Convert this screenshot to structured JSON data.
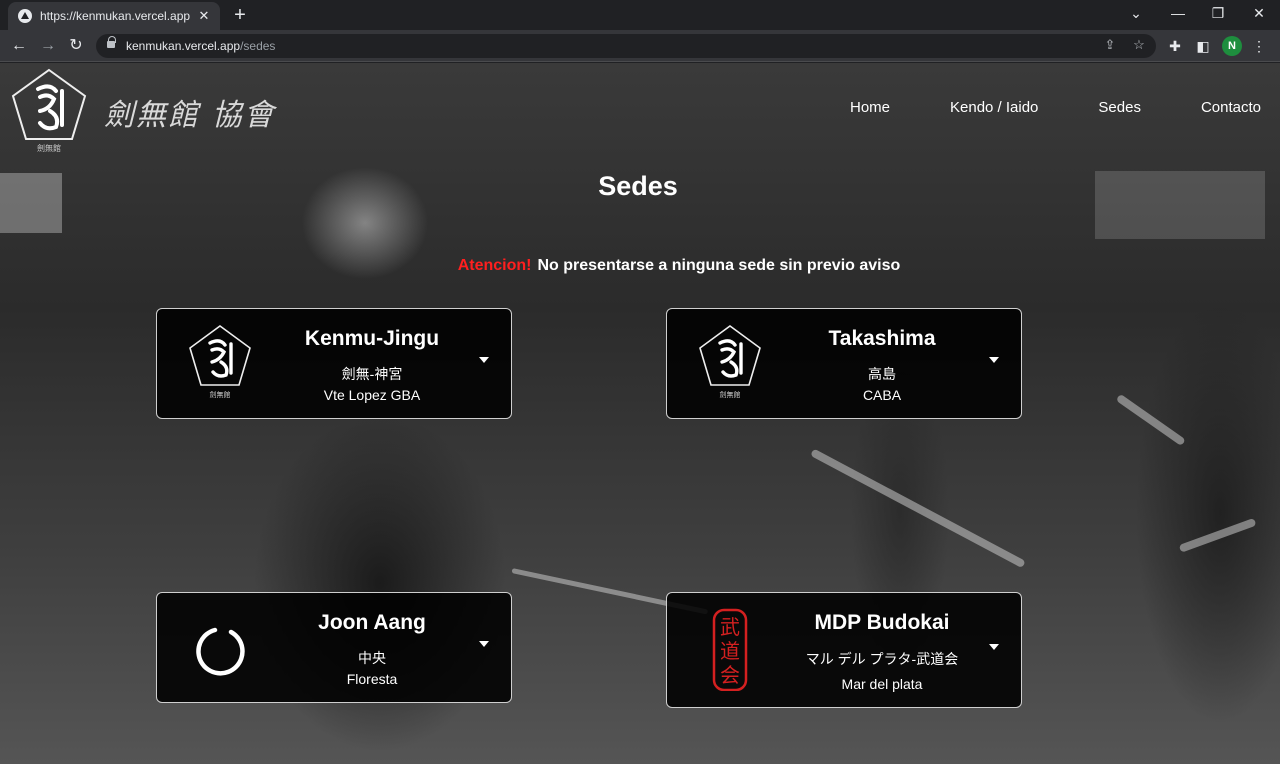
{
  "browser": {
    "tab_title": "https://kenmukan.vercel.app/sedes",
    "url_domain": "kenmukan.vercel.app",
    "url_path": "/sedes",
    "profile_initial": "N"
  },
  "site": {
    "brand_text": "劍無館 協會",
    "logo_caption": "劍無館",
    "nav": [
      "Home",
      "Kendo / Iaido",
      "Sedes",
      "Contacto"
    ]
  },
  "page": {
    "title": "Sedes",
    "notice_alert": "Atencion!",
    "notice_text": "No presentarse a ninguna sede sin previo aviso"
  },
  "sedes": [
    {
      "name": "Kenmu-Jingu",
      "jp": "劍無-神宮",
      "location": "Vte Lopez GBA",
      "icon": "kenmukan-logo-icon"
    },
    {
      "name": "Takashima",
      "jp": "高島",
      "location": "CABA",
      "icon": "kenmukan-logo-icon"
    },
    {
      "name": "Joon Aang",
      "jp": "中央",
      "location": "Floresta",
      "icon": "enso-circle-icon"
    },
    {
      "name": "MDP Budokai",
      "jp": "マル デル プラタ-武道会",
      "location": "Mar del plata",
      "icon": "budokai-seal-icon",
      "icon_text": "武道会",
      "icon_color": "#d42020"
    }
  ]
}
